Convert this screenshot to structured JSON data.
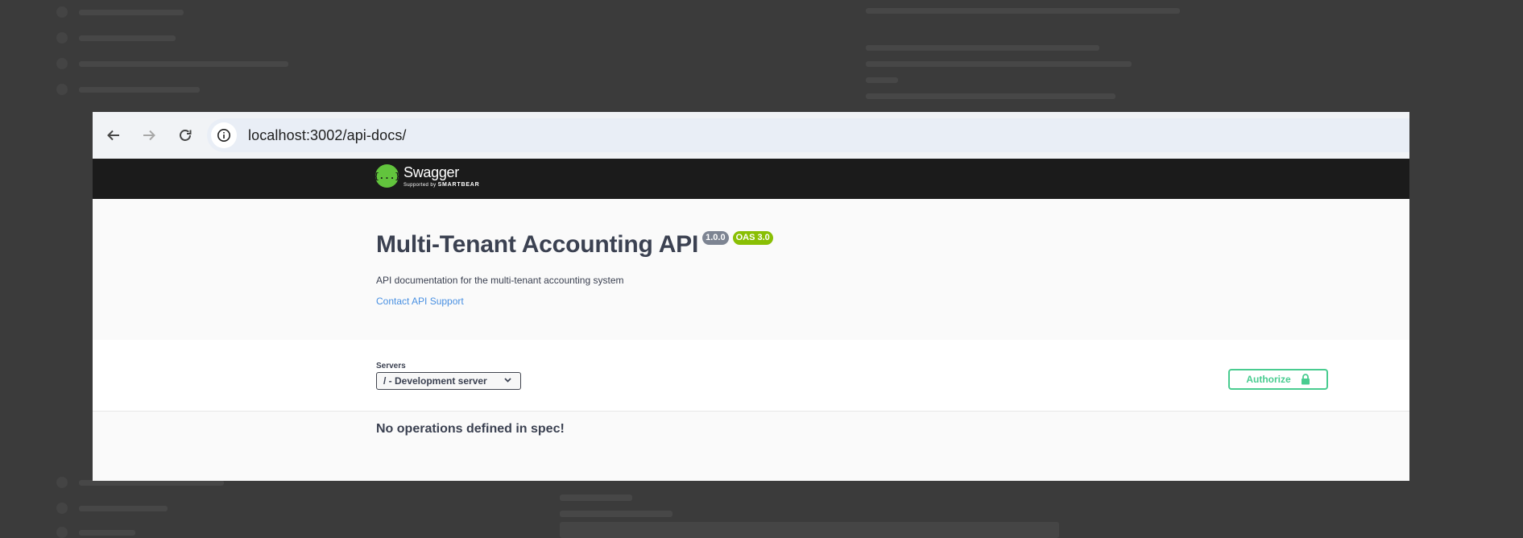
{
  "browser": {
    "url": "localhost:3002/api-docs/"
  },
  "swagger": {
    "brand": "Swagger",
    "brand_sub_prefix": "Supported by",
    "brand_sub_company": "SMARTBEAR",
    "logo_glyph": "{...}",
    "title": "Multi-Tenant Accounting API",
    "version_badge": "1.0.0",
    "oas_badge": "OAS 3.0",
    "description": "API documentation for the multi-tenant accounting system",
    "contact_link": "Contact API Support",
    "servers_label": "Servers",
    "selected_server": "/ - Development server",
    "authorize_label": "Authorize",
    "no_operations": "No operations defined in spec!"
  },
  "colors": {
    "swagger_green": "#62c43d",
    "authorize_green": "#49cc90",
    "oas_badge": "#89bf04",
    "version_badge": "#7d8492",
    "link_blue": "#4990e2",
    "text_dark": "#3b4151"
  },
  "icons": {
    "back": "arrow-left-icon",
    "forward": "arrow-right-icon",
    "reload": "reload-icon",
    "site_info": "info-icon",
    "select_chevron": "chevron-down-icon",
    "authorize": "lock-icon"
  }
}
